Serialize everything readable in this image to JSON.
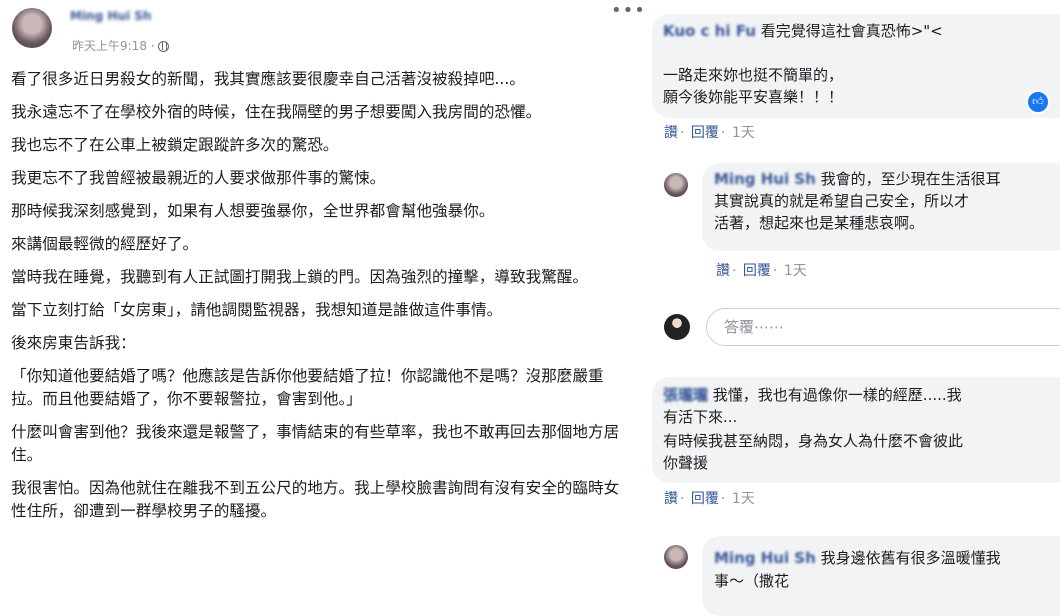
{
  "post": {
    "author": "Ming Hui Sh",
    "time": "昨天上午9:18 ·",
    "more": "•••",
    "paragraphs": [
      "看了很多近日男殺女的新聞，我其實應該要很慶幸自己活著沒被殺掉吧...。",
      "我永遠忘不了在學校外宿的時候，住在我隔壁的男子想要闖入我房間的恐懼。",
      "我也忘不了在公車上被鎖定跟蹤許多次的驚恐。",
      "我更忘不了我曾經被最親近的人要求做那件事的驚悚。",
      "那時候我深刻感覺到，如果有人想要強暴你，全世界都會幫他強暴你。",
      "來講個最輕微的經歷好了。",
      "當時我在睡覺，我聽到有人正試圖打開我上鎖的門。因為強烈的撞擊，導致我驚醒。",
      "當下立刻打給「女房東」，請他調閱監視器，我想知道是誰做這件事情。",
      "後來房東告訴我：",
      "「你知道他要結婚了嗎？他應該是告訴你他要結婚了拉！你認識他不是嗎？沒那麼嚴重拉。而且他要結婚了，你不要報警拉，會害到他。」",
      "什麼叫會害到他？我後來還是報警了，事情結束的有些草率，我也不敢再回去那個地方居住。",
      "我很害怕。因為他就住在離我不到五公尺的地方。我上學校臉書詢問有沒有安全的臨時女性住所，卻遭到一群學校男子的騷擾。"
    ]
  },
  "comments": {
    "c1": {
      "name": "Kuo c hi Fu",
      "text1": "看完覺得這社會真恐怖>\"<",
      "text2": "一路走來妳也挺不簡單的，",
      "text3": "願今後妳能平安喜樂！！！",
      "like": "讚",
      "reply": "回覆",
      "time": "1天"
    },
    "c2": {
      "name": "Ming Hui Sh",
      "text1": "我會的，至少現在生活很耳",
      "text2": "其實說真的就是希望自己安全，所以才",
      "text3": "活著，想起來也是某種悲哀啊。",
      "like": "讚",
      "reply": "回覆",
      "time": "1天"
    },
    "reply_placeholder": "答覆⋯⋯",
    "c3": {
      "name": "張瓏瓏",
      "text1": "我懂，我也有過像你一樣的經歷.....我",
      "text2": "有活下來...",
      "text3": "有時候我甚至納悶，身為女人為什麼不會彼此",
      "text4": "你聲援",
      "like": "讚",
      "reply": "回覆",
      "time": "1天"
    },
    "c4": {
      "name": "Ming Hui Sh",
      "text1": "我身邊依舊有很多溫暖懂我",
      "text2": "事～（撒花"
    }
  },
  "colors": {
    "link": "#385898",
    "bubble": "#f2f3f5",
    "like": "#1877f2"
  }
}
